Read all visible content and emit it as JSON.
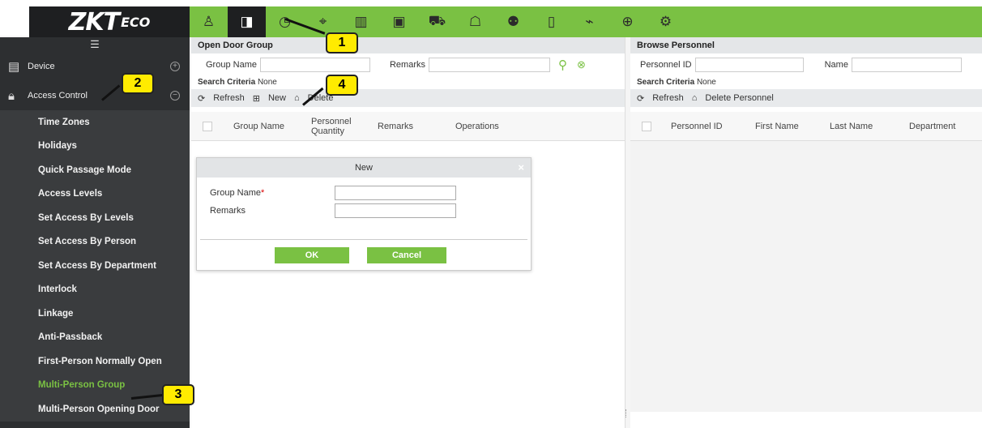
{
  "logo": {
    "main": "ZKT",
    "tail": "ECO"
  },
  "nav_icons": [
    "person-icon",
    "door-icon",
    "clock-icon",
    "turnstile-icon",
    "elevator-icon",
    "visitor-icon",
    "car-icon",
    "patrol-icon",
    "people-group-icon",
    "device-icon",
    "camera-icon",
    "shield-plus-icon",
    "gear-icon"
  ],
  "nav_glyphs": [
    "♙",
    "◨",
    "◷",
    "⌖",
    "▥",
    "▣",
    "⛟",
    "☖",
    "⚉",
    "▯",
    "⌁",
    "⊕",
    "⚙"
  ],
  "sidebar": {
    "groups": [
      {
        "label": "Device",
        "toggle": "+"
      },
      {
        "label": "Access Control",
        "toggle": "−"
      }
    ],
    "items": [
      "Time Zones",
      "Holidays",
      "Quick Passage Mode",
      "Access Levels",
      "Set Access By Levels",
      "Set Access By Person",
      "Set Access By Department",
      "Interlock",
      "Linkage",
      "Anti-Passback",
      "First-Person Normally Open",
      "Multi-Person Group",
      "Multi-Person Opening Door"
    ],
    "active_item": "Multi-Person Group"
  },
  "left_panel": {
    "title": "Open Door Group",
    "group_name_label": "Group Name",
    "remarks_label": "Remarks",
    "criteria_label": "Search Criteria",
    "criteria_value": "None",
    "toolbar": {
      "refresh": "Refresh",
      "new": "New",
      "delete": "Delete"
    },
    "columns": [
      "Group Name",
      "Personnel\nQuantity",
      "Remarks",
      "Operations"
    ]
  },
  "right_panel": {
    "title": "Browse Personnel",
    "personnel_id_label": "Personnel ID",
    "name_label": "Name",
    "criteria_label": "Search Criteria",
    "criteria_value": "None",
    "toolbar": {
      "refresh": "Refresh",
      "delete": "Delete Personnel"
    },
    "columns": [
      "Personnel ID",
      "First Name",
      "Last Name",
      "Department"
    ]
  },
  "dialog": {
    "title": "New",
    "close": "×",
    "group_name_label": "Group Name",
    "required_mark": "*",
    "remarks_label": "Remarks",
    "ok": "OK",
    "cancel": "Cancel"
  },
  "callouts": [
    "1",
    "2",
    "3",
    "4"
  ],
  "colors": {
    "accent": "#7ac143",
    "sidebar": "#2d2f31",
    "callout": "#ffeb00"
  }
}
